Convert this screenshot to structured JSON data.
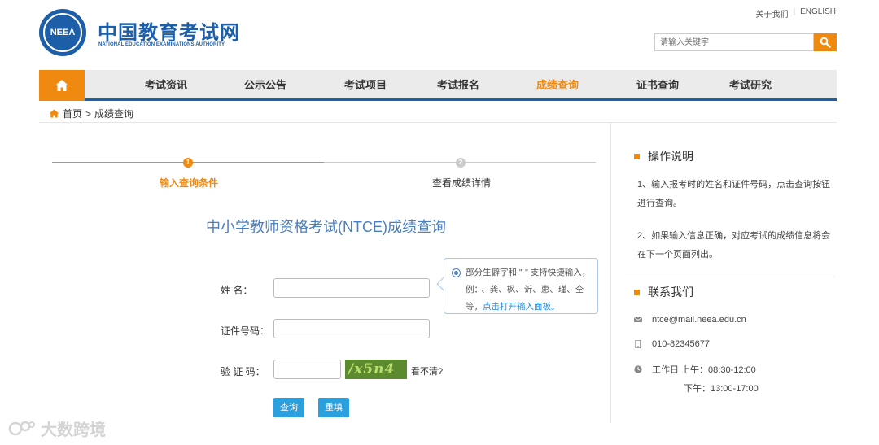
{
  "header": {
    "logo_emblem_text": "NEEA",
    "site_title": "中国教育考试网",
    "site_subtitle": "NATIONAL EDUCATION EXAMINATIONS AUTHORITY",
    "top_links": [
      "关于我们",
      "ENGLISH"
    ],
    "top_links_separator": "|",
    "search_placeholder": "请输入关键字"
  },
  "nav": {
    "items": [
      "考试资讯",
      "公示公告",
      "考试项目",
      "考试报名",
      "成绩查询",
      "证书查询",
      "考试研究"
    ],
    "active": "成绩查询"
  },
  "breadcrumb": {
    "home": "首页",
    "separator": ">",
    "current": "成绩查询"
  },
  "steps": [
    {
      "number": "1",
      "label": "输入查询条件",
      "state": "active"
    },
    {
      "number": "2",
      "label": "查看成绩详情",
      "state": "pending"
    }
  ],
  "form": {
    "title": "中小学教师资格考试(NTCE)成绩查询",
    "name_label": "姓    名：",
    "id_label": "证件号码：",
    "captcha_label": "验 证 码：",
    "captcha_text": "/x5n4",
    "captcha_refresh": "看不清?",
    "submit_label": "查询",
    "reset_label": "重填",
    "tip_text": "部分生僻字和 \"·\" 支持快捷输入，例：·、龚、枫、䜣、惠、瑾、仝等，",
    "tip_link": "点击打开输入面板。"
  },
  "sidebar": {
    "instructions_title": "操作说明",
    "instructions": [
      "1、输入报考时的姓名和证件号码，点击查询按钮进行查询。",
      "2、如果输入信息正确，对应考试的成绩信息将会在下一个页面列出。"
    ],
    "contact_title": "联系我们",
    "email": "ntce@mail.neea.edu.cn",
    "phone": "010-82345677",
    "hours_am": "工作日 上午：08:30-12:00",
    "hours_pm": "下午：13:00-17:00"
  },
  "watermark": "大数跨境",
  "colors": {
    "brand_blue": "#1d5ea8",
    "accent_orange": "#f0890f",
    "button_blue": "#2aa0de"
  }
}
